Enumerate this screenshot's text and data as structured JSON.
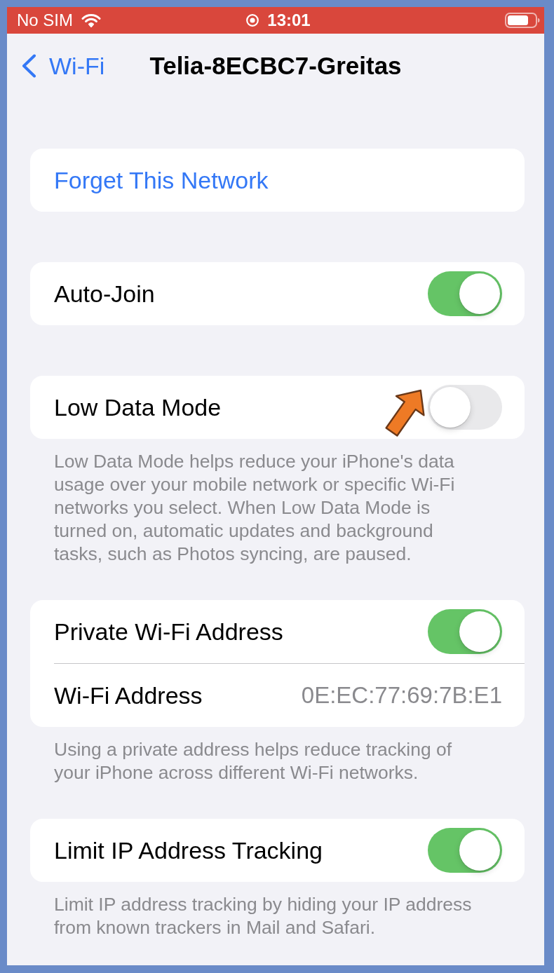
{
  "status_bar": {
    "carrier": "No SIM",
    "time": "13:01"
  },
  "nav_bar": {
    "back_label": "Wi-Fi",
    "title": "Telia-8ECBC7-Greitas"
  },
  "sections": [
    {
      "rows": [
        {
          "kind": "action",
          "label": "Forget This Network",
          "annotated": false
        }
      ]
    },
    {
      "rows": [
        {
          "kind": "toggle",
          "label": "Auto-Join",
          "on": true,
          "annotated": false
        }
      ]
    },
    {
      "rows": [
        {
          "kind": "toggle",
          "label": "Low Data Mode",
          "on": false,
          "annotated": true
        }
      ],
      "footer": "Low Data Mode helps reduce your iPhone's data usage over your mobile network or specific Wi-Fi networks you select. When Low Data Mode is turned on, automatic updates and background tasks, such as Photos syncing, are paused."
    },
    {
      "rows": [
        {
          "kind": "toggle",
          "label": "Private Wi-Fi Address",
          "on": true,
          "annotated": false
        },
        {
          "kind": "value",
          "label": "Wi-Fi Address",
          "value": "0E:EC:77:69:7B:E1",
          "annotated": false
        }
      ],
      "footer": "Using a private address helps reduce tracking of your iPhone across different Wi-Fi networks."
    },
    {
      "rows": [
        {
          "kind": "toggle",
          "label": "Limit IP Address Tracking",
          "on": true,
          "annotated": false
        }
      ],
      "footer": "Limit IP address tracking by hiding your IP address from known trackers in Mail and Safari."
    }
  ]
}
